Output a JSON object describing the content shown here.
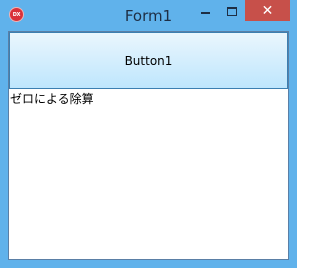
{
  "window": {
    "title": "Form1",
    "icon_label": "DX",
    "icon_name": "dx-app-icon",
    "controls": {
      "minimize_icon": "minimize-icon",
      "maximize_icon": "maximize-icon",
      "close_glyph": "✕",
      "close_icon": "close-icon"
    }
  },
  "form": {
    "button1_label": "Button1",
    "message_text": "ゼロによる除算"
  },
  "colors": {
    "frame": "#60b2eb",
    "close_button": "#c7504a",
    "button_gradient_top": "#eaf6fd",
    "button_gradient_bottom": "#bee6fd",
    "button_border": "#3c7fb1"
  }
}
